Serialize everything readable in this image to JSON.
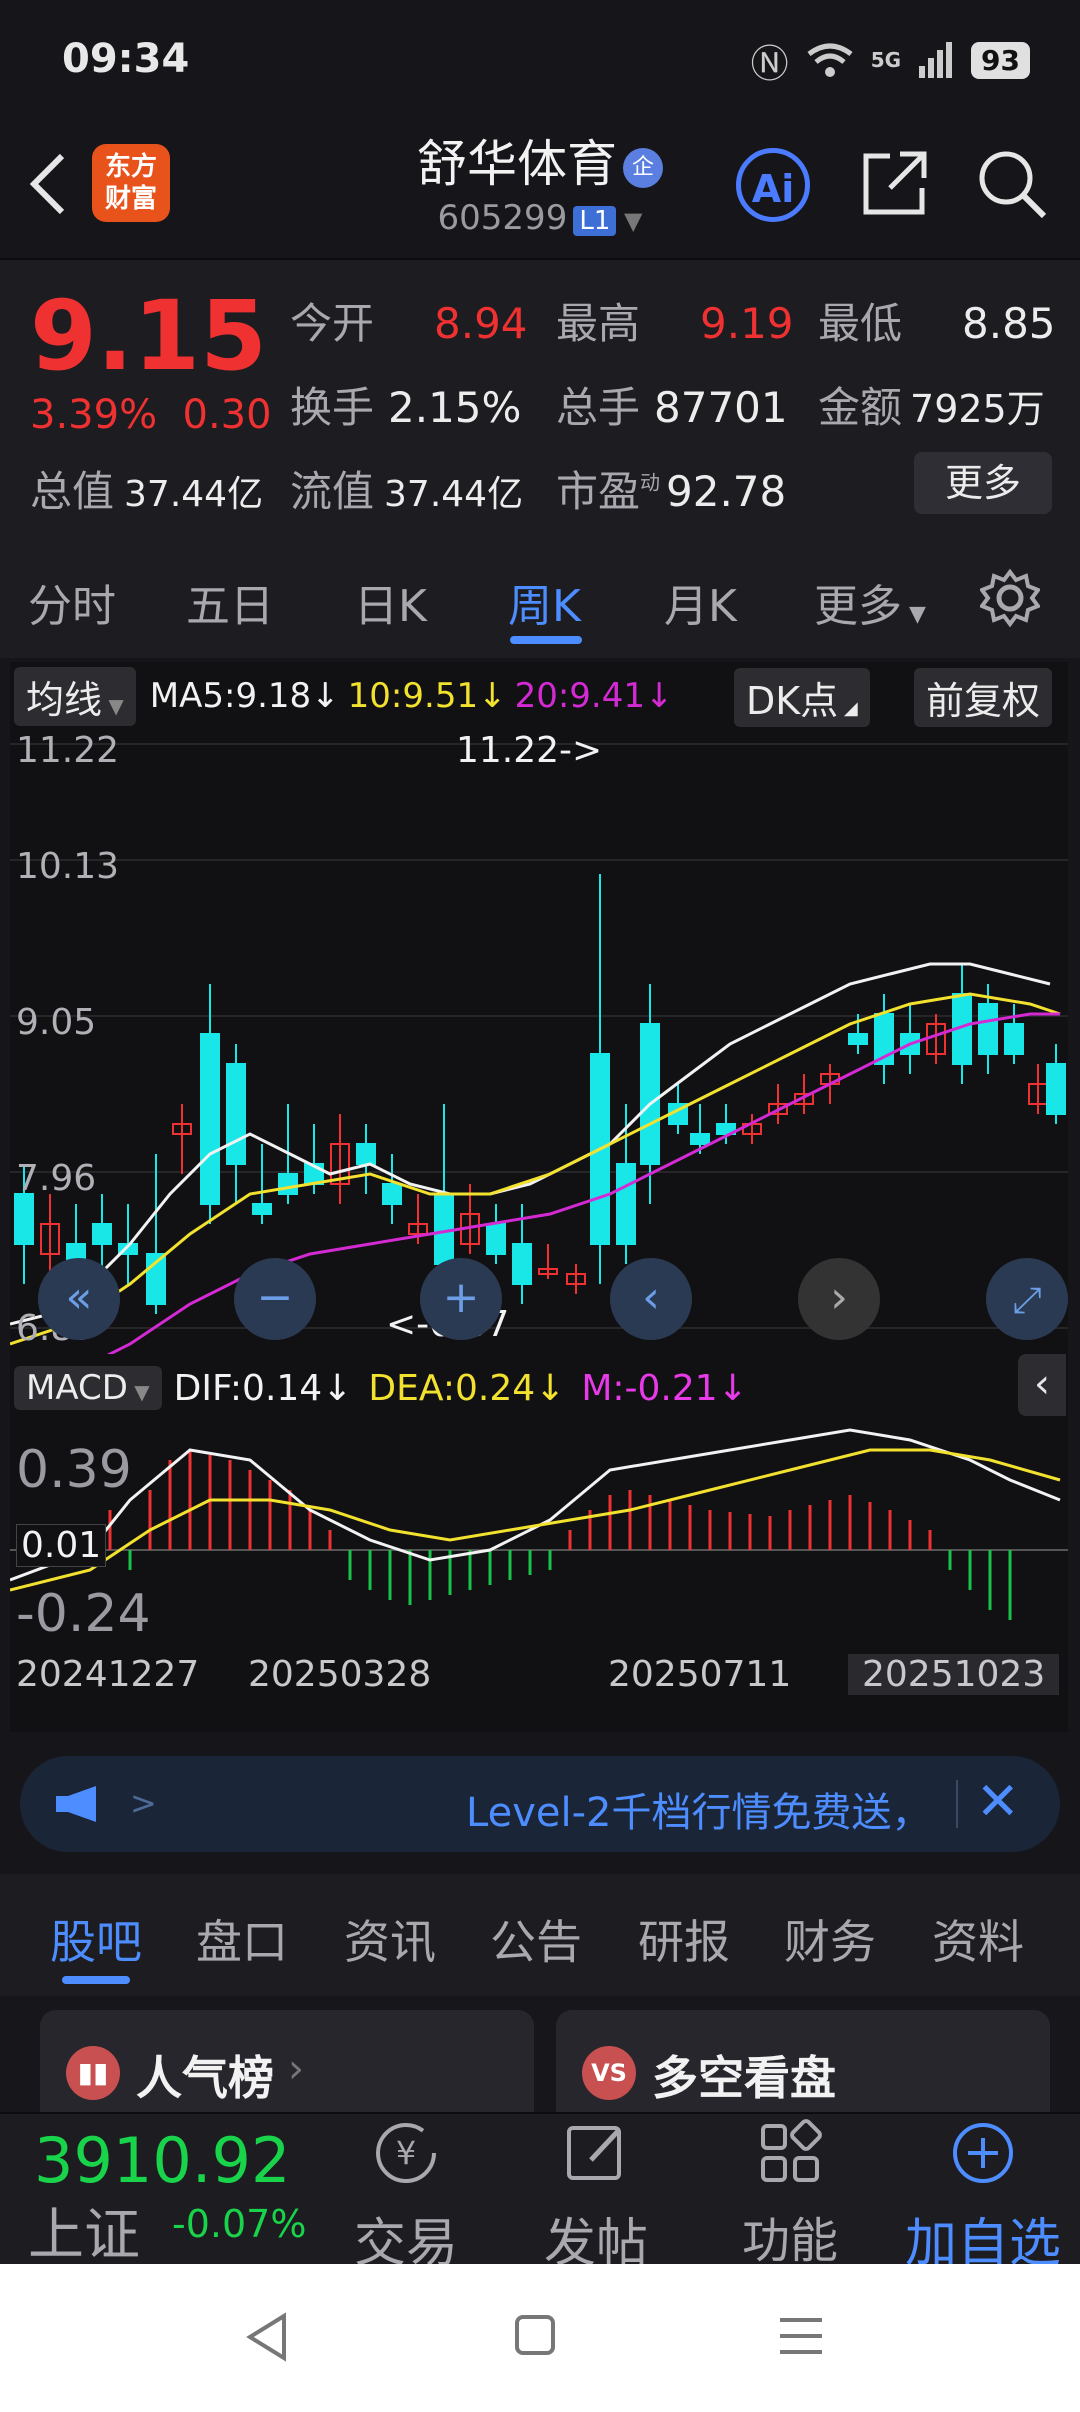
{
  "status_bar": {
    "time": "09:34",
    "network": "5G",
    "battery": "93"
  },
  "header": {
    "logo_line1": "东方",
    "logo_line2": "财富",
    "stock_name": "舒华体育",
    "enterprise_badge": "企",
    "stock_code": "605299",
    "level_badge": "L1",
    "ai_label": "Ai"
  },
  "quote": {
    "price": "9.15",
    "change_pct": "3.39%",
    "change_abs": "0.30",
    "open_label": "今开",
    "open": "8.94",
    "high_label": "最高",
    "high": "9.19",
    "low_label": "最低",
    "low": "8.85",
    "turnover_label": "换手",
    "turnover": "2.15%",
    "volume_label": "总手",
    "volume": "87701",
    "amount_label": "金额",
    "amount": "7925万",
    "mktcap_label": "总值",
    "mktcap": "37.44亿",
    "float_label": "流值",
    "float": "37.44亿",
    "pe_label": "市盈",
    "pe_sup": "动",
    "pe": "92.78",
    "more_label": "更多"
  },
  "period_tabs": [
    "分时",
    "五日",
    "日K",
    "周K",
    "月K",
    "更多"
  ],
  "active_period": "周K",
  "kline": {
    "indicator_btn": "均线",
    "ma5": "MA5:9.18",
    "ma10": "10:9.51",
    "ma20": "20:9.41",
    "dk_btn": "DK点",
    "adjust_btn": "前复权",
    "y_labels": [
      "11.22",
      "10.13",
      "9.05",
      "7.96",
      "6.87"
    ],
    "max_marker": "11.22->",
    "min_marker": "<-6.87"
  },
  "macd": {
    "btn": "MACD",
    "dif": "DIF:0.14",
    "dea": "DEA:0.24",
    "m": "M:-0.21",
    "y_labels": [
      "0.39",
      "0.01",
      "-0.24"
    ]
  },
  "dates": [
    "20241227",
    "20250328",
    "20250711",
    "20251023"
  ],
  "ad": {
    "text": "Level-2千档行情免费送，"
  },
  "bottom_tabs": [
    "股吧",
    "盘口",
    "资讯",
    "公告",
    "研报",
    "财务",
    "资料"
  ],
  "active_bottom_tab": "股吧",
  "cards": {
    "left": "人气榜",
    "right": "多空看盘",
    "vs": "VS"
  },
  "dock": {
    "index_value": "3910.92",
    "index_name": "上证",
    "index_change": "-0.07%",
    "trade": "交易",
    "post": "发帖",
    "function": "功能",
    "add_watch": "加自选"
  },
  "colors": {
    "up": "#f03131",
    "down": "#19e6e6",
    "accent": "#4d8dff",
    "ma10": "#f2e12e",
    "ma20": "#d42ad4"
  }
}
